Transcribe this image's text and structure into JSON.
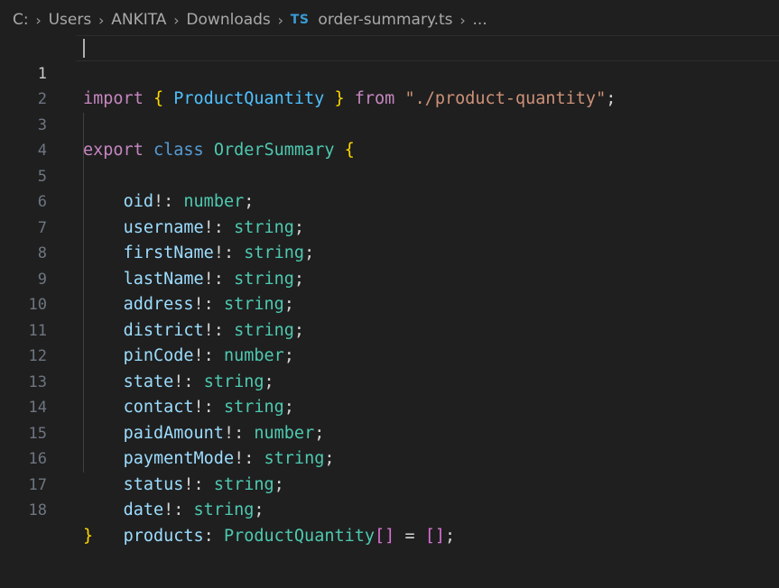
{
  "breadcrumb": {
    "drive": "C:",
    "folders": [
      "Users",
      "ANKITA",
      "Downloads"
    ],
    "file_badge": "TS",
    "file_name": "order-summary.ts",
    "trailing": "..."
  },
  "editor": {
    "current_line": 1,
    "lines": [
      {
        "number": "1"
      },
      {
        "number": "2"
      },
      {
        "number": "3"
      },
      {
        "number": "4"
      },
      {
        "number": "5"
      },
      {
        "number": "6"
      },
      {
        "number": "7"
      },
      {
        "number": "8"
      },
      {
        "number": "9"
      },
      {
        "number": "10"
      },
      {
        "number": "11"
      },
      {
        "number": "12"
      },
      {
        "number": "13"
      },
      {
        "number": "14"
      },
      {
        "number": "15"
      },
      {
        "number": "16"
      },
      {
        "number": "17"
      },
      {
        "number": "18"
      }
    ],
    "import_line": {
      "kw_import": "import",
      "open_brace": "{",
      "name": "ProductQuantity",
      "close_brace": "}",
      "kw_from": "from",
      "path": "\"./product-quantity\"",
      "semi": ";"
    },
    "class_line": {
      "kw_export": "export",
      "kw_class": "class",
      "name": "OrderSummary",
      "open_brace": "{"
    },
    "fields": [
      {
        "name": "oid",
        "bang": "!:",
        "type": "number"
      },
      {
        "name": "username",
        "bang": "!:",
        "type": "string"
      },
      {
        "name": "firstName",
        "bang": "!:",
        "type": "string"
      },
      {
        "name": "lastName",
        "bang": "!:",
        "type": "string"
      },
      {
        "name": "address",
        "bang": "!:",
        "type": "string"
      },
      {
        "name": "district",
        "bang": "!:",
        "type": "string"
      },
      {
        "name": "pinCode",
        "bang": "!:",
        "type": "number"
      },
      {
        "name": "state",
        "bang": "!:",
        "type": "string"
      },
      {
        "name": "contact",
        "bang": "!:",
        "type": "string"
      },
      {
        "name": "paidAmount",
        "bang": "!:",
        "type": "number"
      },
      {
        "name": "paymentMode",
        "bang": "!:",
        "type": "string"
      },
      {
        "name": "status",
        "bang": "!:",
        "type": "string"
      },
      {
        "name": "date",
        "bang": "!:",
        "type": "string"
      }
    ],
    "products_line": {
      "name": "products",
      "colon": ":",
      "type": "ProductQuantity",
      "array": "[]",
      "eq": "=",
      "value": "[]",
      "semi": ";"
    },
    "close_line": {
      "close_brace": "}"
    }
  },
  "colors": {
    "background": "#1f1f1f",
    "keyword_control": "#c586c0",
    "keyword": "#569cd6",
    "brace": "#ffd700",
    "class_name": "#4ec9b0",
    "string": "#ce9178",
    "property": "#9cdcfe",
    "ts_badge": "#3a9bd6"
  }
}
